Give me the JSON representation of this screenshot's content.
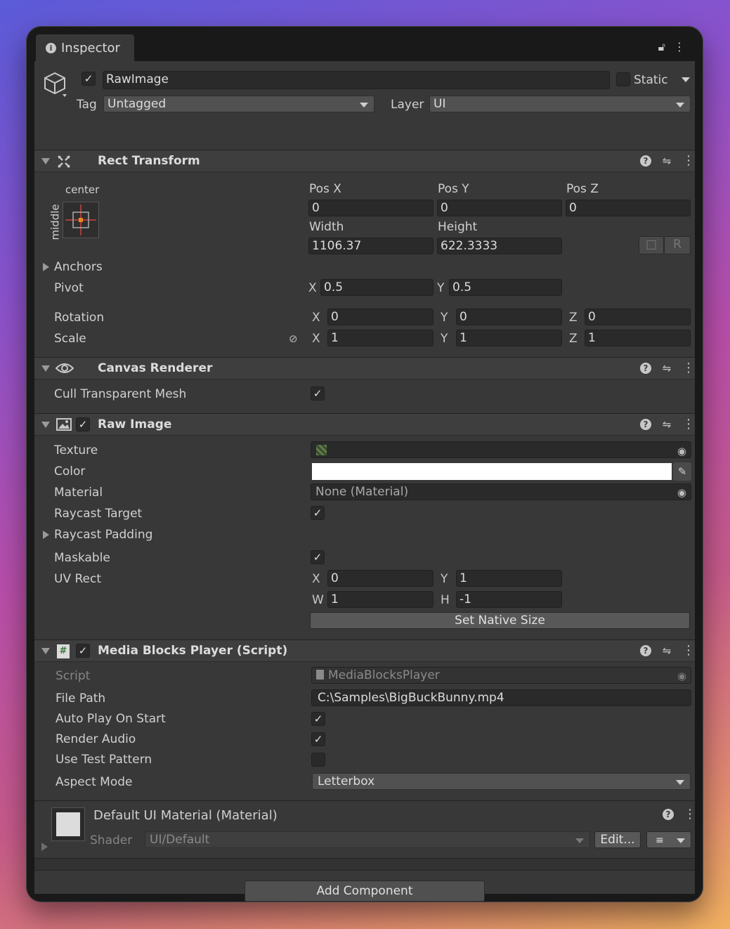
{
  "window": {
    "tab_label": "Inspector"
  },
  "gameobject": {
    "name": "RawImage",
    "static_label": "Static",
    "tag_label": "Tag",
    "tag_value": "Untagged",
    "layer_label": "Layer",
    "layer_value": "UI"
  },
  "rect_transform": {
    "title": "Rect Transform",
    "anchor_h": "center",
    "anchor_v": "middle",
    "pos_x_label": "Pos X",
    "pos_y_label": "Pos Y",
    "pos_z_label": "Pos Z",
    "pos_x": "0",
    "pos_y": "0",
    "pos_z": "0",
    "width_label": "Width",
    "height_label": "Height",
    "width": "1106.37",
    "height": "622.3333",
    "raw_btn": "R",
    "anchors_label": "Anchors",
    "pivot_label": "Pivot",
    "pivot_x": "0.5",
    "pivot_y": "0.5",
    "rotation_label": "Rotation",
    "rot_x": "0",
    "rot_y": "0",
    "rot_z": "0",
    "scale_label": "Scale",
    "scale_x": "1",
    "scale_y": "1",
    "scale_z": "1",
    "axis_x": "X",
    "axis_y": "Y",
    "axis_z": "Z",
    "axis_w": "W",
    "axis_h": "H"
  },
  "canvas_renderer": {
    "title": "Canvas Renderer",
    "cull_label": "Cull Transparent Mesh",
    "cull_checked": true
  },
  "raw_image": {
    "title": "Raw Image",
    "texture_label": "Texture",
    "color_label": "Color",
    "color_value": "#ffffff",
    "material_label": "Material",
    "material_value": "None (Material)",
    "raycast_target_label": "Raycast Target",
    "raycast_padding_label": "Raycast Padding",
    "maskable_label": "Maskable",
    "uvrect_label": "UV Rect",
    "uv_x": "0",
    "uv_y": "1",
    "uv_w": "1",
    "uv_h": "-1",
    "native_size_btn": "Set Native Size"
  },
  "media_player": {
    "title": "Media Blocks Player (Script)",
    "script_label": "Script",
    "script_value": "MediaBlocksPlayer",
    "filepath_label": "File Path",
    "filepath_value": "C:\\Samples\\BigBuckBunny.mp4",
    "autoplay_label": "Auto Play On Start",
    "render_audio_label": "Render Audio",
    "test_pattern_label": "Use Test Pattern",
    "aspect_label": "Aspect Mode",
    "aspect_value": "Letterbox"
  },
  "material": {
    "title": "Default UI Material (Material)",
    "shader_label": "Shader",
    "shader_value": "UI/Default",
    "edit_btn": "Edit..."
  },
  "add_component_btn": "Add Component"
}
